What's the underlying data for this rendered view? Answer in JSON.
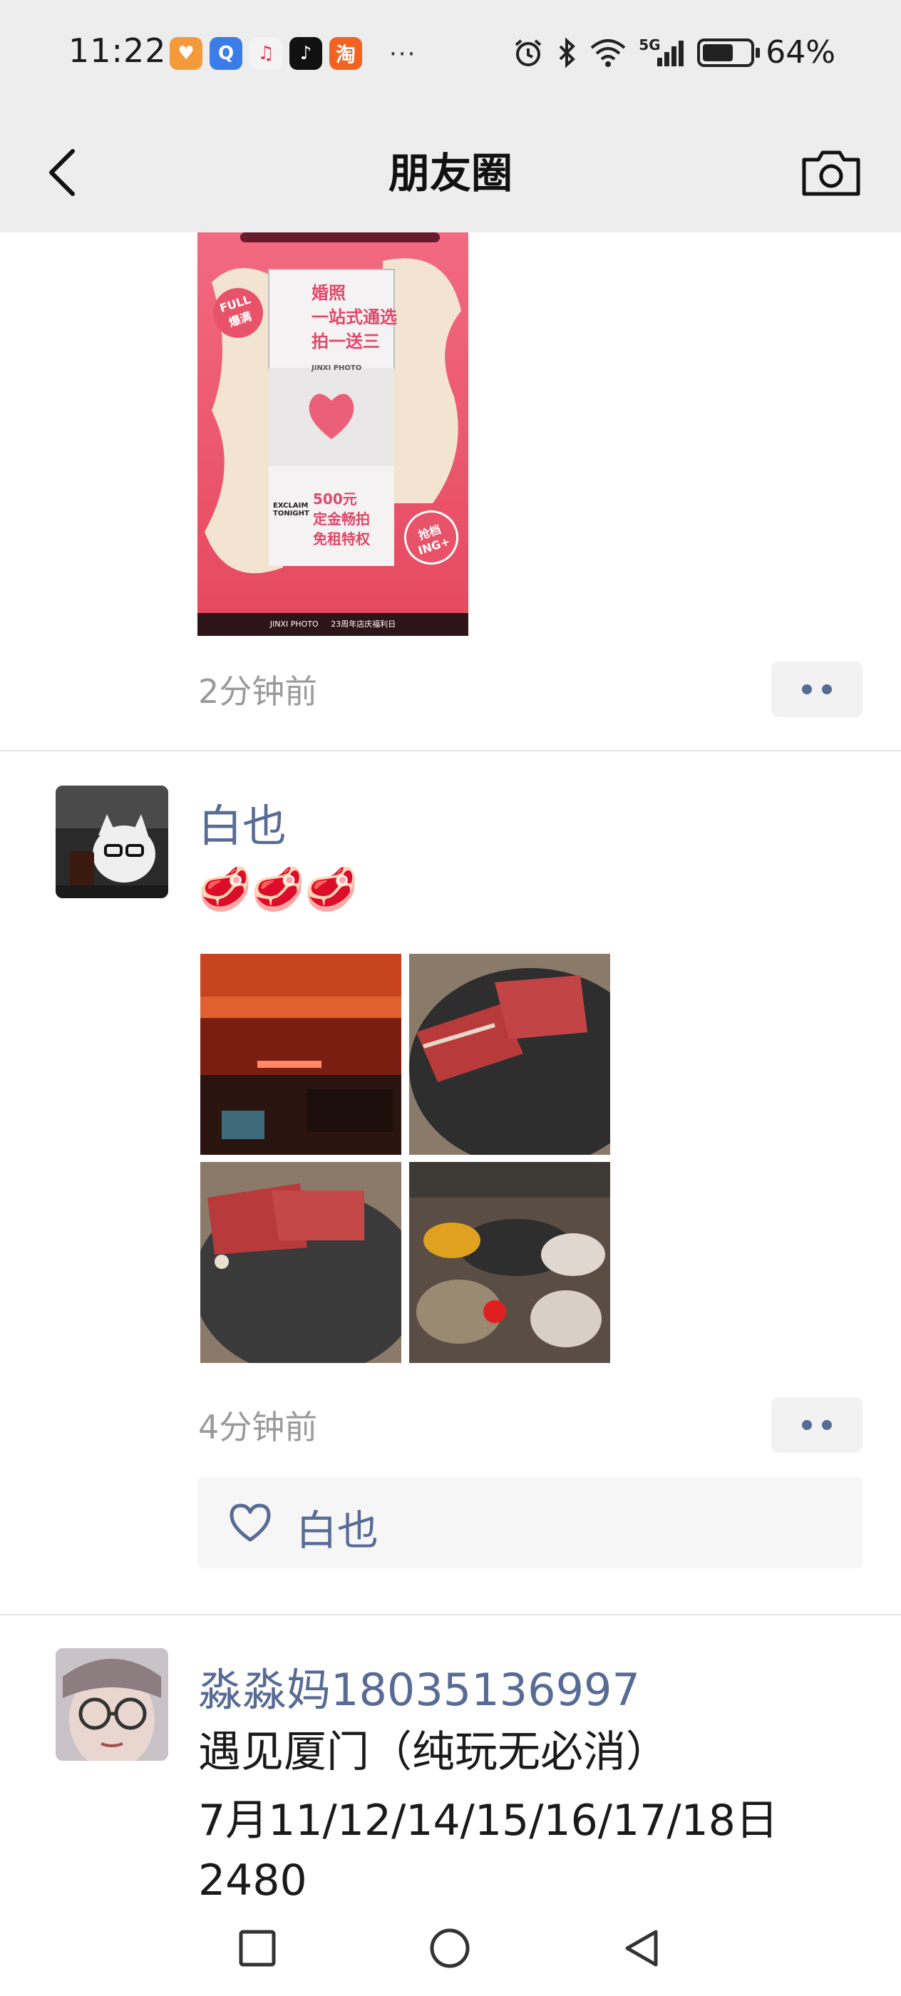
{
  "status_bar": {
    "time": "11:22",
    "battery_pct": "64%",
    "network": "5G",
    "more": "···",
    "app_icons": [
      {
        "name": "shopping-app-icon",
        "color": "#f59a3a",
        "glyph": "♥"
      },
      {
        "name": "search-app-icon",
        "color": "#3b7de8",
        "glyph": "Q"
      },
      {
        "name": "music-app-icon",
        "color": "#f3f3f3",
        "glyph": "♫"
      },
      {
        "name": "tiktok-app-icon",
        "color": "#111111",
        "glyph": "♪"
      },
      {
        "name": "taobao-app-icon",
        "color": "#f26322",
        "glyph": "淘"
      }
    ]
  },
  "nav": {
    "title": "朋友圈"
  },
  "posts": [
    {
      "time": "2分钟前"
    },
    {
      "nickname": "白也",
      "text": "🥩🥩🥩",
      "time": "4分钟前",
      "likes": [
        "白也"
      ]
    },
    {
      "nickname": "淼淼妈18035136997",
      "text_lines": [
        "遇见厦门（纯玩无必消）",
        "7月11/12/14/15/16/17/18日",
        "2480"
      ]
    }
  ],
  "poster": {
    "line1": "婚照",
    "line2": "一站式通选",
    "line3": "拍一送三",
    "brand": "JINXI PHOTO",
    "badge_left": "FULL\n爆满",
    "box3_line1": "500元",
    "box3_line2": "定金畅拍",
    "box3_line3": "免租特权",
    "box3_brand": "EXCLAIM\nTONIGHT",
    "badge_right": "抢档\nING+",
    "footer": "JINXI PHOTO     23周年店庆福利日"
  },
  "colors": {
    "accent_link": "#576b95",
    "time_gray": "#9a9a9a",
    "bar_bg": "#ededed"
  }
}
